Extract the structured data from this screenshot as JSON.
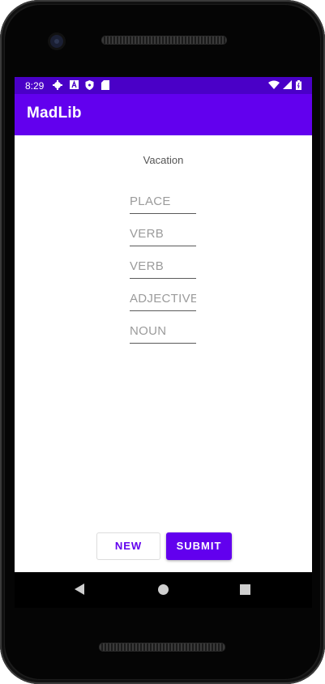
{
  "status_bar": {
    "time": "8:29",
    "left_icons": [
      "gear-icon",
      "font-icon",
      "shield-icon",
      "sd-card-icon"
    ],
    "right_icons": [
      "wifi-icon",
      "signal-icon",
      "battery-icon"
    ]
  },
  "app_bar": {
    "title": "MadLib",
    "color": "#6200ee"
  },
  "story": {
    "title": "Vacation"
  },
  "fields": [
    {
      "placeholder": "PLACE",
      "value": ""
    },
    {
      "placeholder": "VERB",
      "value": ""
    },
    {
      "placeholder": "VERB",
      "value": ""
    },
    {
      "placeholder": "ADJECTIVE",
      "value": ""
    },
    {
      "placeholder": "NOUN",
      "value": ""
    }
  ],
  "buttons": {
    "new_label": "NEW",
    "submit_label": "SUBMIT"
  },
  "colors": {
    "primary": "#6200ee",
    "primary_dark": "#4a00c7",
    "background": "#ffffff"
  }
}
